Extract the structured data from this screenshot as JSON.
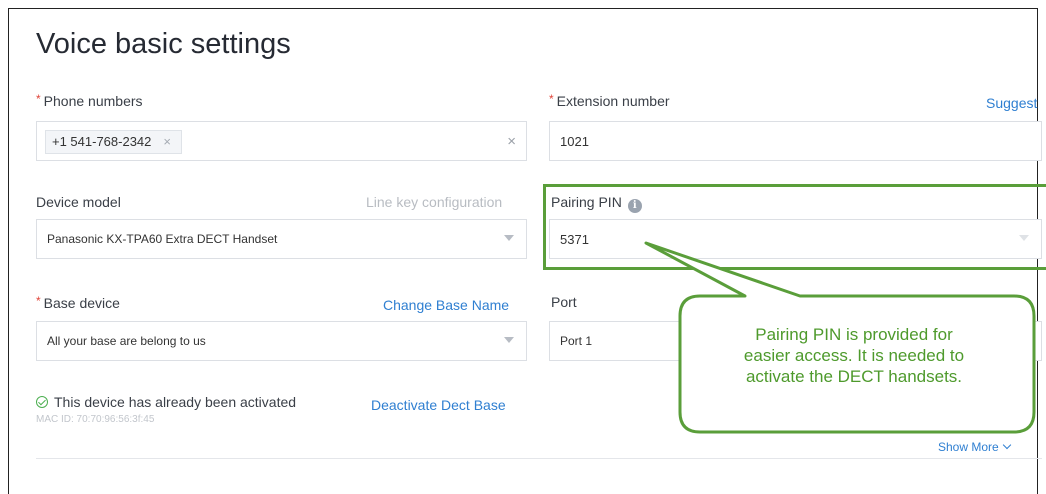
{
  "page": {
    "title": "Voice basic settings"
  },
  "phone_numbers": {
    "label": "Phone numbers",
    "chip": "+1 541-768-2342",
    "chip_remove": "×",
    "clear": "×"
  },
  "extension": {
    "label": "Extension number",
    "value": "1021",
    "suggest": "Suggest"
  },
  "device_model": {
    "label": "Device model",
    "line_key_config": "Line key configuration",
    "value": "Panasonic KX-TPA60 Extra DECT Handset"
  },
  "pairing_pin": {
    "label": "Pairing PIN",
    "info": "i",
    "value": "5371"
  },
  "base_device": {
    "label": "Base device",
    "change_base_name": "Change Base Name",
    "value": "All your base are belong to us"
  },
  "port": {
    "label": "Port",
    "value": "Port 1"
  },
  "activation": {
    "status": "This device has already been activated",
    "deactivate": "Deactivate Dect Base",
    "mac": "MAC ID: 70:70:96:56:3f:45"
  },
  "show_more": "Show More",
  "callout": {
    "line1": "Pairing PIN is provided for",
    "line2": "easier access. It is needed to",
    "line3": "activate the DECT handsets."
  },
  "colors": {
    "accent_link": "#2f7fd1",
    "required": "#e0453a",
    "highlight_green": "#5a9e3a",
    "callout_text": "#4e9a2c",
    "success": "#4caf50"
  },
  "icons": [
    "info-icon",
    "check-circle-icon",
    "chevron-down-icon",
    "close-icon",
    "dropdown-caret-icon"
  ]
}
